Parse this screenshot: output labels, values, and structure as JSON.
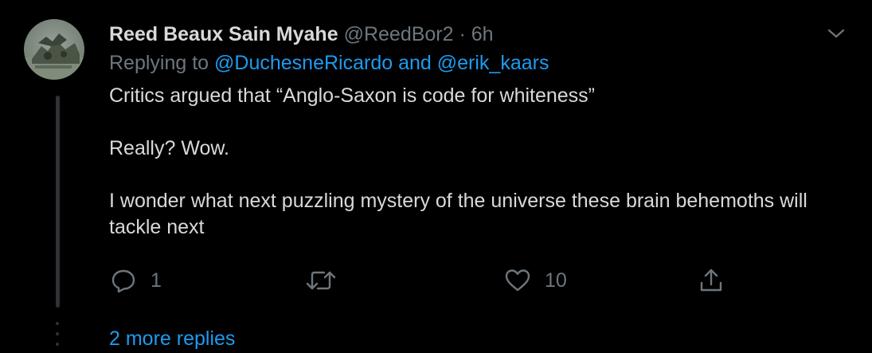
{
  "tweet": {
    "author_name": "Reed Beaux Sain Myahe",
    "handle": "@ReedBor2",
    "separator": "·",
    "time": "6h",
    "replying_prefix": "Replying to",
    "reply_handle_1": "@DuchesneRicardo",
    "reply_and": "and",
    "reply_handle_2": "@erik_kaars",
    "body": [
      "Critics argued that “Anglo-Saxon is code for whiteness”",
      "Really? Wow.",
      "I wonder what next puzzling mystery of the universe these brain behemoths will tackle next"
    ],
    "actions": {
      "reply_count": "1",
      "retweet_count": "",
      "like_count": "10"
    },
    "more_replies": "2 more replies"
  },
  "colors": {
    "background": "#000000",
    "text": "#d9d9d9",
    "muted": "#6e767d",
    "link": "#1d9bf0",
    "thread_line": "#2f3336"
  },
  "icons": [
    "avatar-photo",
    "chevron-down-icon",
    "reply-icon",
    "retweet-icon",
    "like-icon",
    "share-icon"
  ]
}
